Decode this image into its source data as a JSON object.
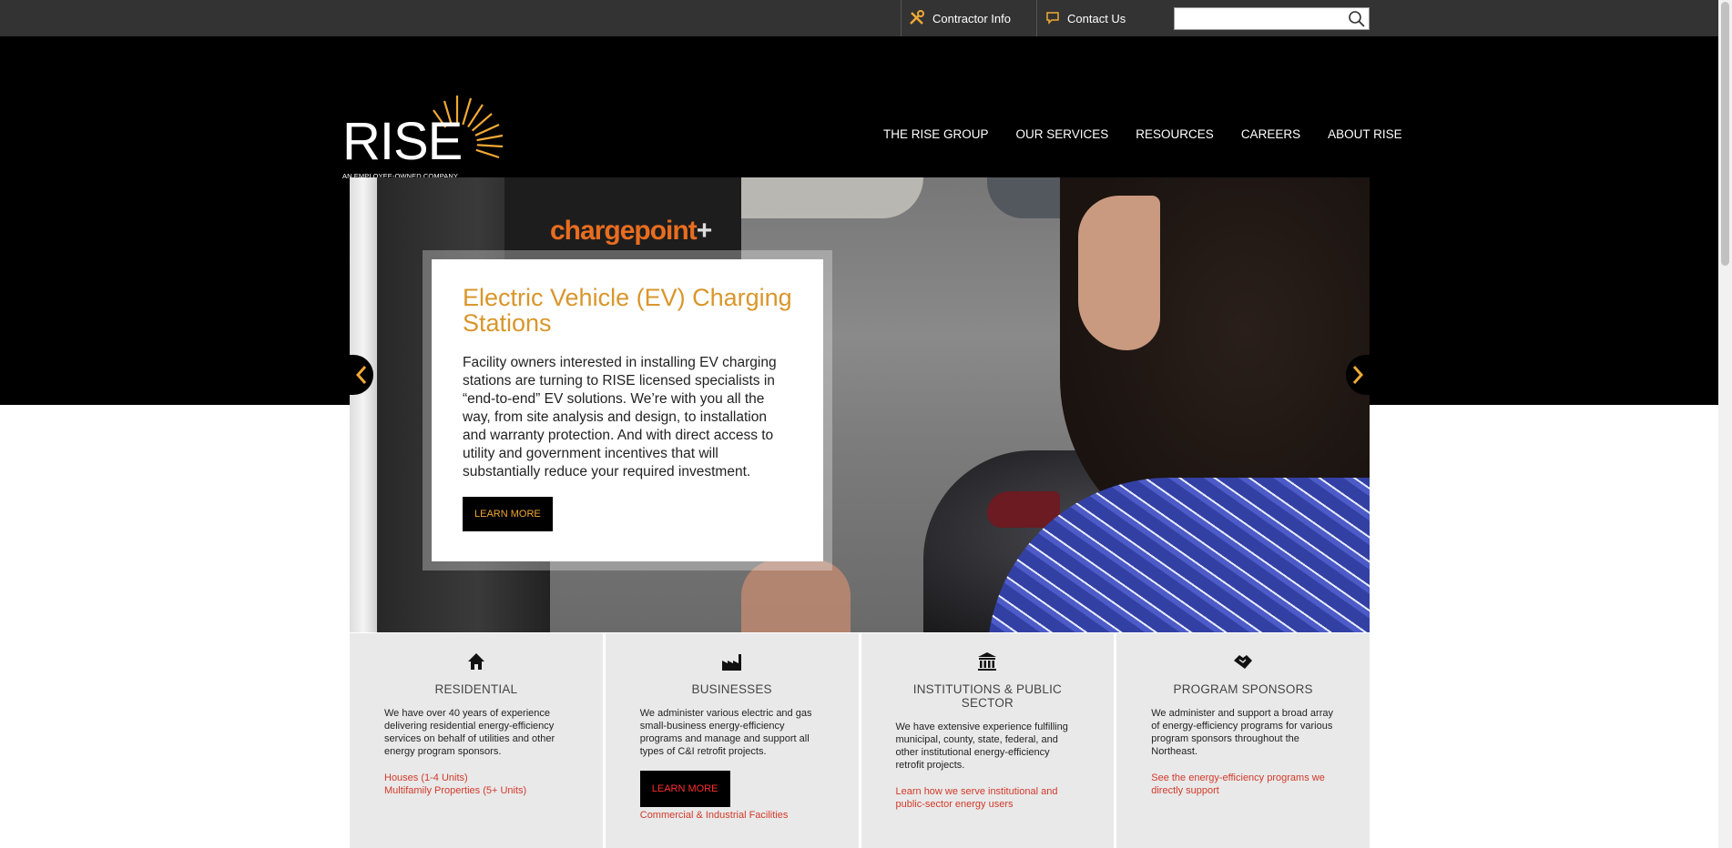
{
  "utility": {
    "contractor_label": "Contractor Info",
    "contact_label": "Contact Us",
    "search_placeholder": ""
  },
  "brand": {
    "logo_word": "RISE",
    "tagline": "AN EMPLOYEE-OWNED COMPANY",
    "accent_color": "#d9962b"
  },
  "nav": {
    "items": [
      "THE RISE GROUP",
      "OUR SERVICES",
      "RESOURCES",
      "CAREERS",
      "ABOUT RISE"
    ]
  },
  "hero": {
    "photo_brand": "chargepoint",
    "photo_brand_plus": "+",
    "title": "Electric Vehicle (EV) Charging Stations",
    "text": "Facility owners interested in installing EV charging stations are turning to RISE licensed specialists in “end-to-end” EV solutions. We’re with you all the way, from site analysis and design, to installation and warranty protection. And with direct access to utility and government incentives that will substantially reduce your required investment.",
    "button": "LEARN MORE"
  },
  "cards": [
    {
      "icon": "home-icon",
      "title": "RESIDENTIAL",
      "text": "We have over 40 years of experience delivering residential energy-efficiency services on behalf of utilities and other energy program sponsors.",
      "links": [
        "Houses (1-4 Units)",
        "Multifamily Properties (5+ Units)"
      ]
    },
    {
      "icon": "factory-icon",
      "title": "BUSINESSES",
      "text": "We administer various electric and gas small-business energy-efficiency programs and manage and support all types of C&I retrofit projects.",
      "button": "LEARN MORE",
      "links": [
        "Commercial & Industrial Facilities"
      ]
    },
    {
      "icon": "institution-icon",
      "title": "INSTITUTIONS & PUBLIC SECTOR",
      "text": "We have extensive experience fulfilling municipal, county, state, federal, and other institutional energy-efficiency retrofit projects.",
      "links": [
        "Learn how we serve institutional and public-sector energy users"
      ]
    },
    {
      "icon": "handshake-icon",
      "title": "PROGRAM SPONSORS",
      "text": "We administer and support a broad array of energy-efficiency programs for various program sponsors throughout the Northeast.",
      "links": [
        "See the energy-efficiency programs we directly support"
      ]
    }
  ]
}
